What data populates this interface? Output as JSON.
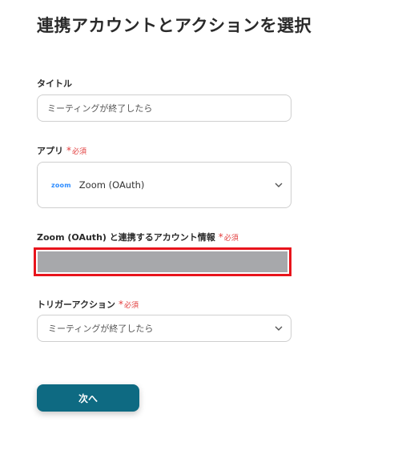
{
  "page": {
    "title": "連携アカウントとアクションを選択"
  },
  "fields": {
    "title_label": "タイトル",
    "title_value": "ミーティングが終了したら",
    "app_label": "アプリ",
    "required_text": "必須",
    "app_logo": "zoom",
    "app_value": "Zoom (OAuth)",
    "account_label": "Zoom (OAuth) と連携するアカウント情報",
    "trigger_label": "トリガーアクション",
    "trigger_value": "ミーティングが終了したら"
  },
  "buttons": {
    "next": "次へ"
  },
  "colors": {
    "accent": "#0e6a82",
    "required": "#e23b3b",
    "highlight": "#e8141c",
    "zoom_blue": "#2d8cff"
  }
}
